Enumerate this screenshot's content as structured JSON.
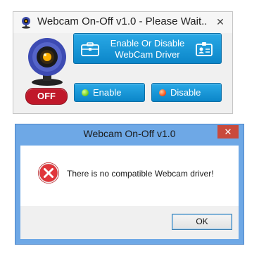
{
  "main_window": {
    "title": "Webcam On-Off v1.0 - Please Wait...",
    "close_glyph": "✕",
    "status_badge": "OFF",
    "driver_button": {
      "line1": "Enable Or Disable",
      "line2": "WebCam Driver"
    },
    "enable_button": "Enable",
    "disable_button": "Disable",
    "icons": {
      "app": "webcam-icon",
      "webcam_graphic": "webcam-icon",
      "driver_left": "toolbox-icon",
      "driver_right": "id-card-icon",
      "enable_dot": "green-dot-icon",
      "disable_dot": "red-dot-icon"
    },
    "colors": {
      "accent": "#1a9ad9",
      "off_badge": "#c0182a",
      "enable_dot": "#7ed321",
      "disable_dot": "#ff5a1f"
    }
  },
  "dialog": {
    "title": "Webcam On-Off v1.0",
    "close_glyph": "✕",
    "message": "There is no compatible Webcam driver!",
    "ok_button": "OK",
    "icons": {
      "error": "error-icon"
    },
    "colors": {
      "frame": "#6ea8e6",
      "close": "#c94a3c",
      "error": "#d3262c"
    }
  }
}
